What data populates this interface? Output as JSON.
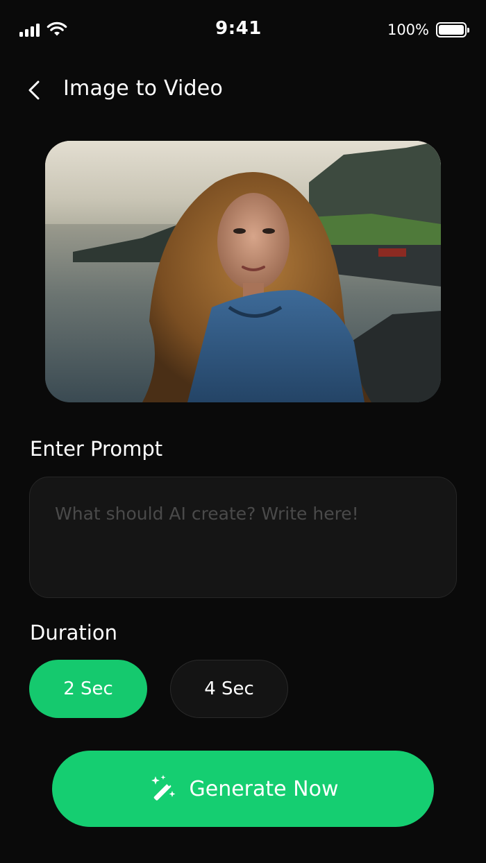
{
  "status_bar": {
    "time": "9:41",
    "battery_percent": "100%",
    "signal_icon": "cellular-signal-icon",
    "wifi_icon": "wifi-icon",
    "battery_icon": "battery-icon"
  },
  "header": {
    "back_icon": "chevron-left-icon",
    "title": "Image to Video"
  },
  "prompt": {
    "label": "Enter Prompt",
    "value": "",
    "placeholder": "What should AI create? Write here!"
  },
  "duration": {
    "label": "Duration",
    "options": [
      {
        "label": "2 Sec",
        "selected": true
      },
      {
        "label": "4 Sec",
        "selected": false
      }
    ]
  },
  "generate": {
    "label": "Generate Now",
    "icon": "magic-wand-icon"
  },
  "colors": {
    "background": "#0a0a0a",
    "accent": "#15ce71",
    "input_bg": "#151515",
    "placeholder": "#4a4a4a"
  }
}
